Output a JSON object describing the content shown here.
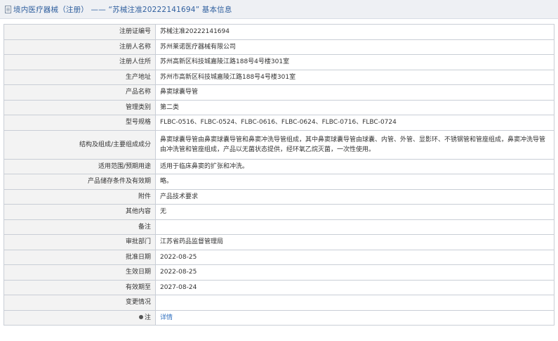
{
  "header": {
    "title": "境内医疗器械（注册） —— “苏械注准20222141694” 基本信息"
  },
  "rows": [
    {
      "label": "注册证编号",
      "value": "苏械注准20222141694"
    },
    {
      "label": "注册人名称",
      "value": "苏州莱诺医疗器械有限公司"
    },
    {
      "label": "注册人住所",
      "value": "苏州高新区科技城嘉陵江路188号4号楼301室"
    },
    {
      "label": "生产地址",
      "value": "苏州市高新区科技城嘉陵江路188号4号楼301室"
    },
    {
      "label": "产品名称",
      "value": "鼻窦球囊导管"
    },
    {
      "label": "管理类别",
      "value": "第二类"
    },
    {
      "label": "型号规格",
      "value": "FLBC-0516、FLBC-0524、FLBC-0616、FLBC-0624、FLBC-0716、FLBC-0724"
    },
    {
      "label": "结构及组成/主要组成成分",
      "value": "鼻窦球囊导管由鼻窦球囊导管和鼻窦冲洗导管组成，其中鼻窦球囊导管由球囊、内管、外管、显影环、不锈钢管和管座组成，鼻窦冲洗导管由冲洗管和管座组成，产品以无菌状态提供，经环氧乙烷灭菌，一次性使用。"
    },
    {
      "label": "适用范围/预期用途",
      "value": "适用于临床鼻窦的扩张和冲洗。"
    },
    {
      "label": "产品储存条件及有效期",
      "value": "略。"
    },
    {
      "label": "附件",
      "value": "产品技术要求"
    },
    {
      "label": "其他内容",
      "value": "无"
    },
    {
      "label": "备注",
      "value": ""
    },
    {
      "label": "审批部门",
      "value": "江苏省药品监督管理局"
    },
    {
      "label": "批准日期",
      "value": "2022-08-25"
    },
    {
      "label": "生效日期",
      "value": "2022-08-25"
    },
    {
      "label": "有效期至",
      "value": "2027-08-24"
    },
    {
      "label": "变更情况",
      "value": ""
    },
    {
      "label": "注",
      "value": "详情"
    }
  ]
}
